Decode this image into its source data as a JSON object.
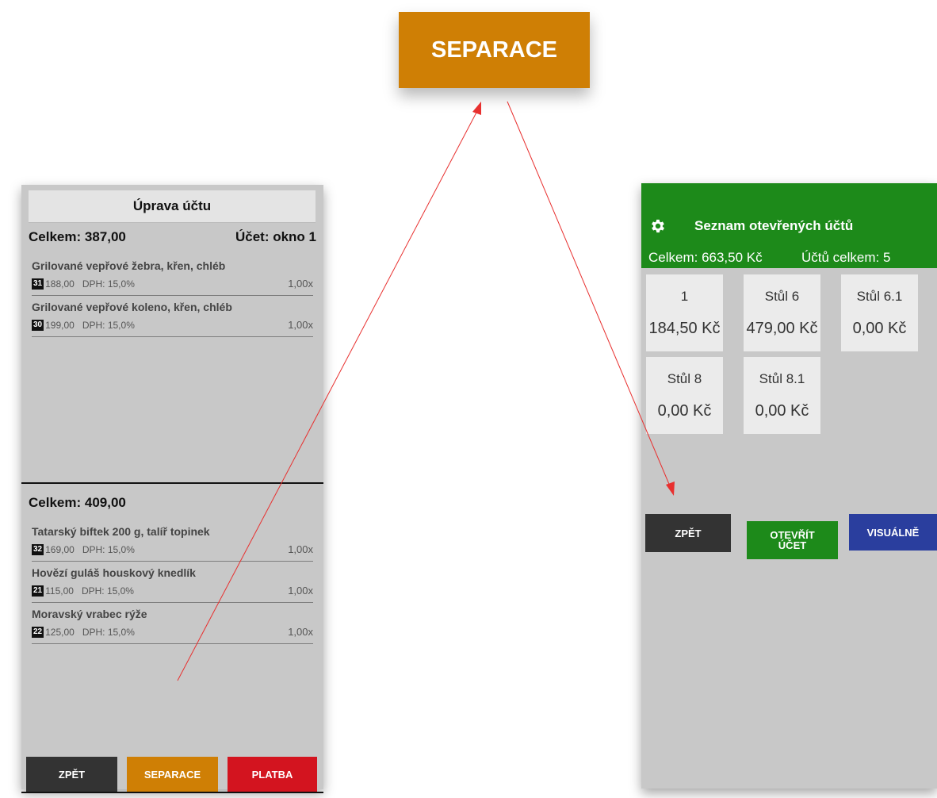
{
  "zoom_button": {
    "label": "SEPARACE"
  },
  "left": {
    "header": "Úprava účtu",
    "top_total": "Celkem: 387,00",
    "account": "Účet: okno 1",
    "top_items": [
      {
        "name": "Grilované vepřové žebra, křen, chléb",
        "badge": "31",
        "price": "188,00",
        "vat": "DPH: 15,0%",
        "qty": "1,00x"
      },
      {
        "name": "Grilované vepřové koleno, křen, chléb",
        "badge": "30",
        "price": "199,00",
        "vat": "DPH: 15,0%",
        "qty": "1,00x"
      }
    ],
    "bottom_total": "Celkem: 409,00",
    "bottom_items": [
      {
        "name": "Tatarský biftek 200 g, talíř topinek",
        "badge": "32",
        "price": "169,00",
        "vat": "DPH: 15,0%",
        "qty": "1,00x"
      },
      {
        "name": "Hovězí guláš houskový knedlík",
        "badge": "21",
        "price": "115,00",
        "vat": "DPH: 15,0%",
        "qty": "1,00x"
      },
      {
        "name": "Moravský vrabec rýže",
        "badge": "22",
        "price": "125,00",
        "vat": "DPH: 15,0%",
        "qty": "1,00x"
      }
    ],
    "buttons": {
      "back": "ZPĚT",
      "separate": "SEPARACE",
      "pay": "PLATBA"
    }
  },
  "right": {
    "icon": "gear-icon",
    "title": "Seznam otevřených účtů",
    "total": "Celkem: 663,50 Kč",
    "count": "Účtů celkem: 5",
    "tiles": [
      {
        "name": "1",
        "amount": "184,50 Kč"
      },
      {
        "name": "Stůl 6",
        "amount": "479,00 Kč"
      },
      {
        "name": "Stůl 6.1",
        "amount": "0,00 Kč"
      },
      {
        "name": "Stůl 8",
        "amount": "0,00 Kč"
      },
      {
        "name": "Stůl 8.1",
        "amount": "0,00 Kč"
      }
    ],
    "buttons": {
      "back": "ZPĚT",
      "open_line1": "OTEVŘÍT",
      "open_line2": "ÚČET",
      "visual": "VISUÁLNĚ"
    }
  },
  "colors": {
    "separate": "#cf7f05",
    "pay": "#d3141f",
    "back": "#333333",
    "green": "#1d8a1a",
    "visual": "#2a3e9e",
    "arrow": "#e8302f"
  }
}
